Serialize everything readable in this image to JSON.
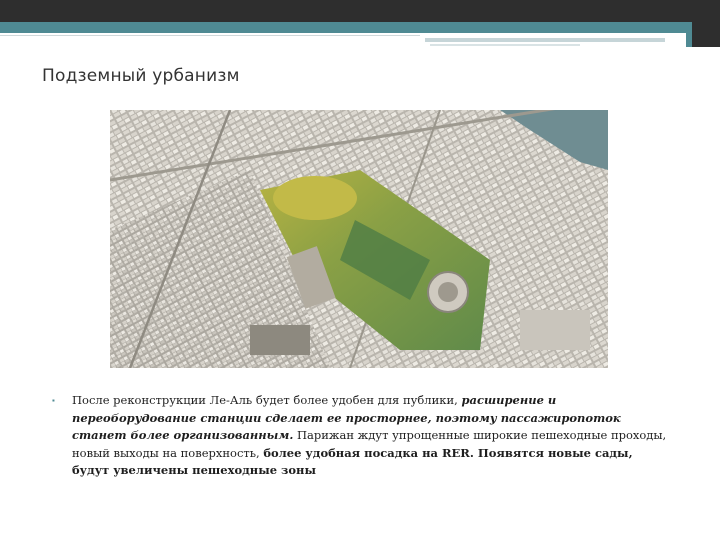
{
  "slide": {
    "title": "Подземный урбанизм",
    "bullet": {
      "part1": "После реконструкции Ле-Аль будет более удобен для публики, ",
      "part2": "расширение и переоборудование станции сделает ее просторнее, поэтому пассажиропоток станет более организованным.",
      "part3": "  Парижан ждут упрощенные широкие пешеходные проходы, новый выходы на поверхность, ",
      "part4": "более удобная посадка на RER. Появятся новые сады, будут увеличены пешеходные зоны"
    }
  },
  "colors": {
    "accent": "#4f8a93",
    "dark_bar": "#2e2e2e",
    "text": "#1e1e1e"
  }
}
